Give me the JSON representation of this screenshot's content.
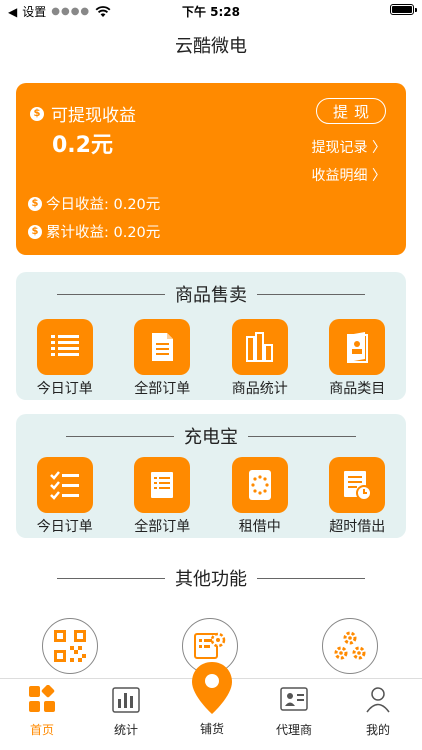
{
  "status_bar": {
    "carrier": "设置",
    "time": "下午 5:28"
  },
  "nav": {
    "title": "云酷微电"
  },
  "earnings": {
    "label": "可提现收益",
    "amount": "0.2元",
    "withdraw_button": "提现",
    "links": [
      "提现记录 〉",
      "收益明细 〉"
    ],
    "today_label": "今日收益: 0.20元",
    "total_label": "累计收益: 0.20元"
  },
  "sales": {
    "title": "商品售卖",
    "items": [
      "今日订单",
      "全部订单",
      "商品统计",
      "商品类目"
    ]
  },
  "powerbank": {
    "title": "充电宝",
    "items": [
      "今日订单",
      "全部订单",
      "租借中",
      "超时借出"
    ]
  },
  "other": {
    "title": "其他功能"
  },
  "tabs": [
    {
      "label": "首页",
      "icon": "home-grid-icon"
    },
    {
      "label": "统计",
      "icon": "bar-chart-icon"
    },
    {
      "label": "铺货",
      "icon": "location-pin-icon"
    },
    {
      "label": "代理商",
      "icon": "agent-card-icon"
    },
    {
      "label": "我的",
      "icon": "person-icon"
    }
  ],
  "colors": {
    "accent": "#ff8a00",
    "section_bg": "#e4f1f1"
  }
}
